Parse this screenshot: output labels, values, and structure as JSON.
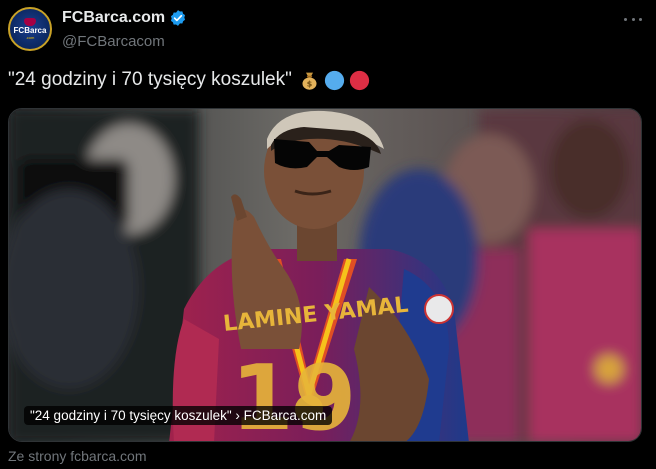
{
  "account": {
    "display_name": "FCBarca.com",
    "handle": "@FCBarcacom",
    "avatar_text": "FCBarca",
    "avatar_subtext": ".com"
  },
  "tweet": {
    "text": "\"24 godziny i 70 tysięcy koszulek\"",
    "emojis": [
      "money-bag-icon",
      "blue-circle-icon",
      "red-circle-icon"
    ]
  },
  "media": {
    "caption": "\"24 godziny i 70 tysięcy koszulek\" › FCBarca.com",
    "jersey_lettering": "LAMINE YAMAL"
  },
  "source": {
    "label": "Ze strony fcbarca.com"
  },
  "colors": {
    "background": "#000000",
    "text": "#e7e9ea",
    "muted": "#71767b",
    "verified": "#1d9bf0",
    "blue_circle": "#55acee",
    "red_circle": "#dd2e44"
  }
}
